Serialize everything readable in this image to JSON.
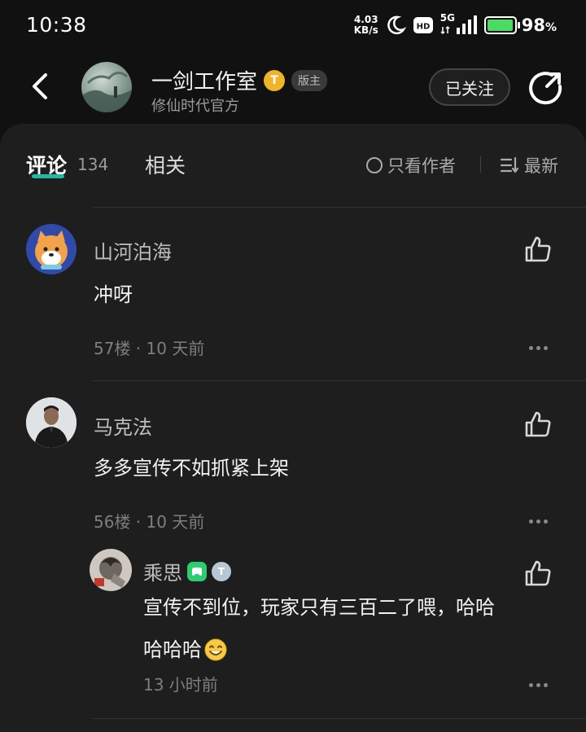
{
  "status_bar": {
    "time": "10:38",
    "net_speed_value": "4.03",
    "net_speed_unit": "KB/s",
    "network": "5G",
    "battery_percent": "98",
    "battery_percent_sign": "%",
    "battery_level": 0.98,
    "icons": [
      "moon-icon",
      "hd-icon",
      "signal-icon",
      "battery-icon"
    ]
  },
  "header": {
    "channel_name": "一剑工作室",
    "level_badge": "T",
    "role_badge": "版主",
    "subtitle": "修仙时代官方",
    "follow_label": "已关注"
  },
  "tabs": {
    "comments_label": "评论",
    "comments_count": "134",
    "related_label": "相关",
    "author_only_label": "只看作者",
    "sort_label": "最新"
  },
  "comments": [
    {
      "username": "山河泊海",
      "text": "冲呀",
      "floor": "57楼",
      "separator": " · ",
      "time": "10 天前"
    },
    {
      "username": "马克法",
      "text": "多多宣传不如抓紧上架",
      "floor": "56楼",
      "separator": " · ",
      "time": "10 天前"
    }
  ],
  "reply": {
    "username": "乘思",
    "badge_level": "T",
    "line1": "宣传不到位，玩家只有三百二了喂，哈哈",
    "line2": "哈哈哈",
    "time": "13 小时前"
  },
  "colors": {
    "accent": "#1fb9a6",
    "background": "#111111",
    "panel": "#1e1e1e",
    "badge_gold": "#f0b429",
    "badge_green": "#2ecc71"
  }
}
